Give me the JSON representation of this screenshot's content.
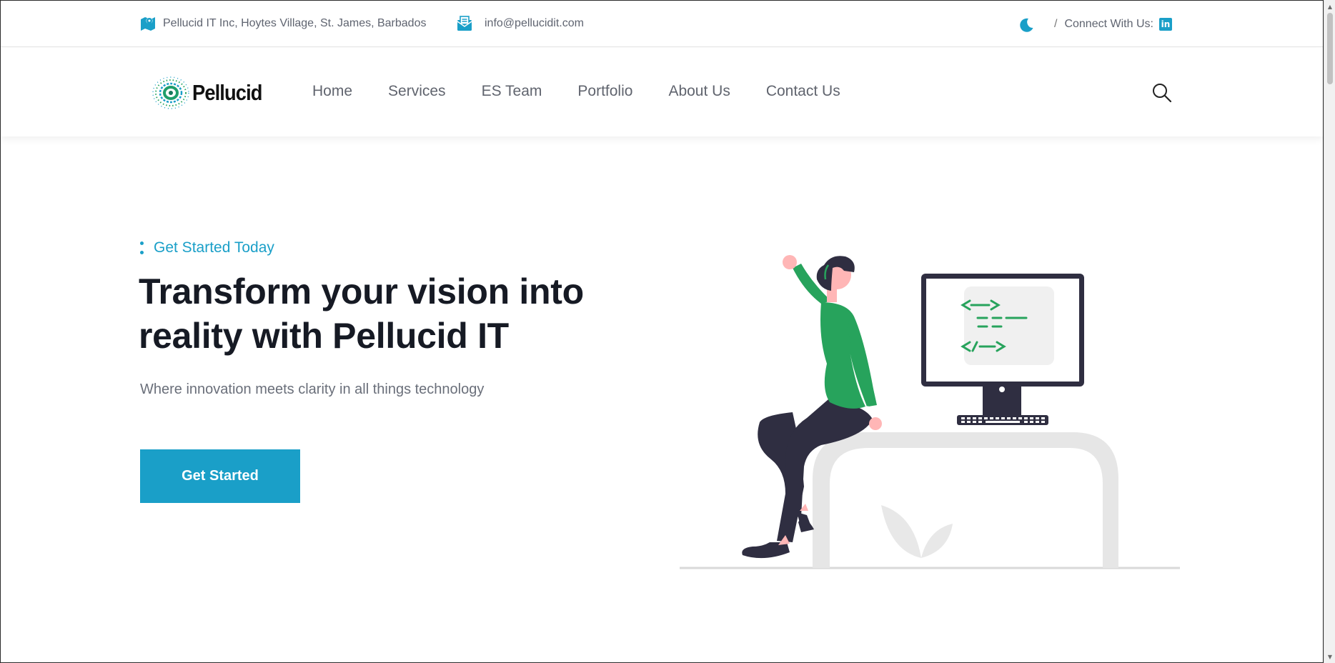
{
  "topbar": {
    "address": "Pellucid IT Inc, Hoytes Village, St. James, Barbados",
    "email": "info@pellucidit.com",
    "separator": "/",
    "connect_label": "Connect With Us:",
    "linkedin_glyph": "in",
    "icons": {
      "address": "map-pin-icon",
      "email": "envelope-icon",
      "theme": "moon-icon",
      "social": "linkedin-icon"
    }
  },
  "header": {
    "logo_text": "Pellucid",
    "nav": [
      {
        "label": "Home"
      },
      {
        "label": "Services"
      },
      {
        "label": "ES Team"
      },
      {
        "label": "Portfolio"
      },
      {
        "label": "About Us"
      },
      {
        "label": "Contact Us"
      }
    ],
    "search_icon": "search-icon"
  },
  "hero": {
    "eyebrow": "Get Started Today",
    "headline_line1": "Transform your vision into",
    "headline_line2": "reality with Pellucid IT",
    "subtitle": "Where innovation meets clarity in all things technology",
    "cta_label": "Get Started"
  },
  "colors": {
    "accent": "#1a9fc8",
    "heading": "#161a24",
    "body_text": "#6a6f7a",
    "illustration_green": "#27a35c"
  }
}
